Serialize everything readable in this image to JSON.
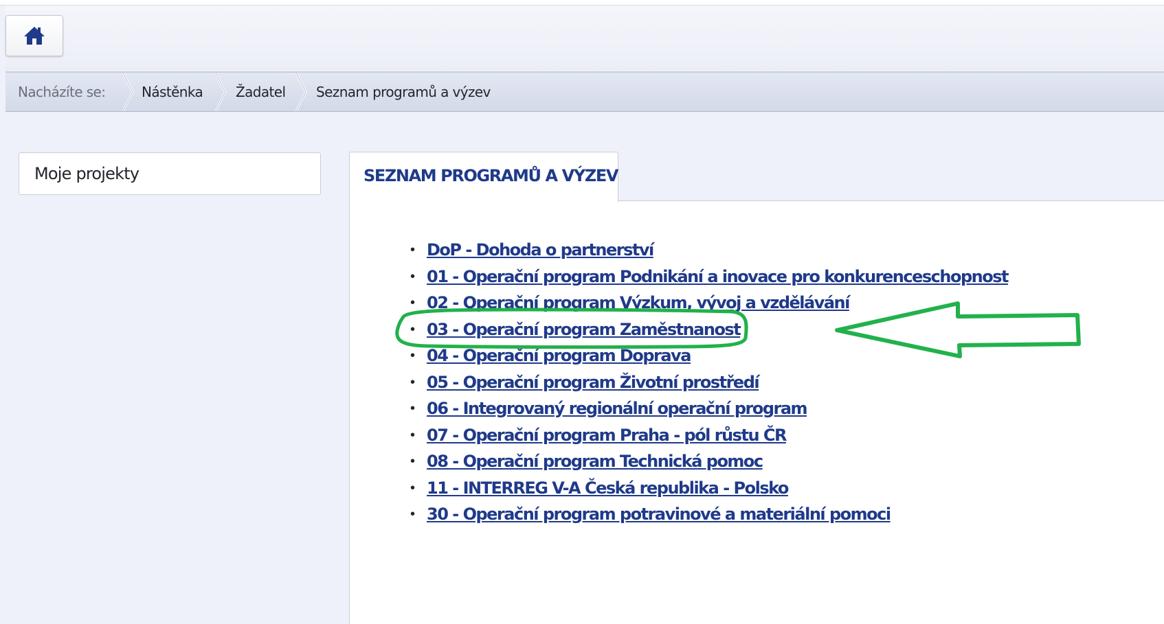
{
  "topbar": {
    "home_icon": "home-icon"
  },
  "breadcrumb": {
    "label": "Nacházíte se:",
    "items": [
      "Nástěnka",
      "Žadatel"
    ],
    "current": "Seznam programů a výzev"
  },
  "sidebar": {
    "item": "Moje projekty"
  },
  "main": {
    "tab": "SEZNAM PROGRAMŮ A VÝZEV",
    "programs": [
      "DoP - Dohoda o partnerství",
      "01 - Operační program Podnikání a inovace pro konkurenceschopnost",
      "02 - Operační program Výzkum, vývoj a vzdělávání",
      "03 - Operační program Zaměstnanost",
      "04 - Operační program Doprava",
      "05 - Operační program Životní prostředí",
      "06 - Integrovaný regionální operační program",
      "07 - Operační program Praha - pól růstu ČR",
      "08 - Operační program Technická pomoc",
      "11 - INTERREG V-A Česká republika - Polsko",
      "30 - Operační program potravinové a materiální pomoci"
    ]
  },
  "colors": {
    "link": "#1f3a8a",
    "annotation": "#22b14c"
  }
}
